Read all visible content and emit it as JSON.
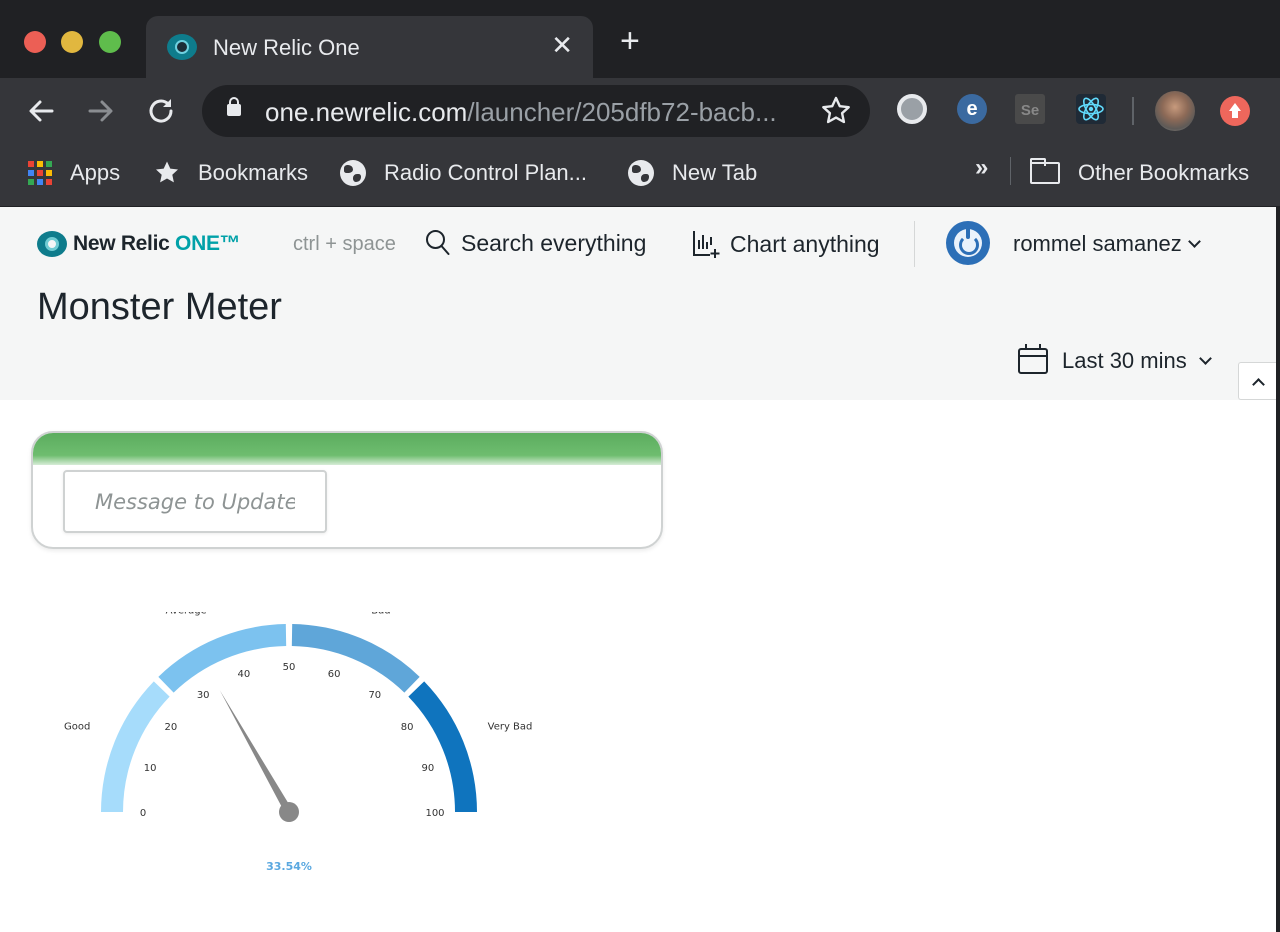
{
  "browser": {
    "tab_title": "New Relic One",
    "tab_close": "✕",
    "new_tab": "+",
    "url_host": "one.newrelic.com",
    "url_path": "/launcher/205dfb72-bacb...",
    "ext_e_label": "e",
    "ext_se_label": "Se",
    "apps_colors": [
      "#ea4335",
      "#fbbc05",
      "#34a853",
      "#4285f4",
      "#ea4335",
      "#fbbc05",
      "#34a853",
      "#4285f4",
      "#ea4335"
    ],
    "bookmarks": [
      {
        "label": "Apps",
        "icon": "apps-grid-icon"
      },
      {
        "label": "Bookmarks",
        "icon": "star-icon"
      },
      {
        "label": "Radio Control Plan...",
        "icon": "globe-icon"
      },
      {
        "label": "New Tab",
        "icon": "globe-icon"
      }
    ],
    "overflow": "»",
    "other_bookmarks": "Other Bookmarks"
  },
  "header": {
    "logo_text": "New Relic ",
    "logo_one": "ONE™",
    "shortcut": "ctrl + space",
    "search_label": "Search everything",
    "chart_label": "Chart anything",
    "user_name": "rommel samanez",
    "page_title": "Monster Meter",
    "time_range": "Last 30 mins"
  },
  "card": {
    "bar_color": "#5cad5f",
    "input_placeholder": "Message to Update",
    "input_value": ""
  },
  "chart_data": {
    "type": "gauge",
    "min": 0,
    "max": 100,
    "value": 33.54,
    "value_label": "33.54%",
    "ticks": [
      0,
      10,
      20,
      30,
      40,
      50,
      60,
      70,
      80,
      90,
      100
    ],
    "bands": [
      {
        "name": "Good",
        "from": 0,
        "to": 25,
        "color": "#a6dcfb"
      },
      {
        "name": "Average",
        "from": 25,
        "to": 50,
        "color": "#7cc2ef"
      },
      {
        "name": "Bad",
        "from": 50,
        "to": 75,
        "color": "#5fa6d9"
      },
      {
        "name": "Very Bad",
        "from": 75,
        "to": 100,
        "color": "#0f74be"
      }
    ],
    "needle_color": "#888888",
    "value_color": "#5aa8e0"
  }
}
